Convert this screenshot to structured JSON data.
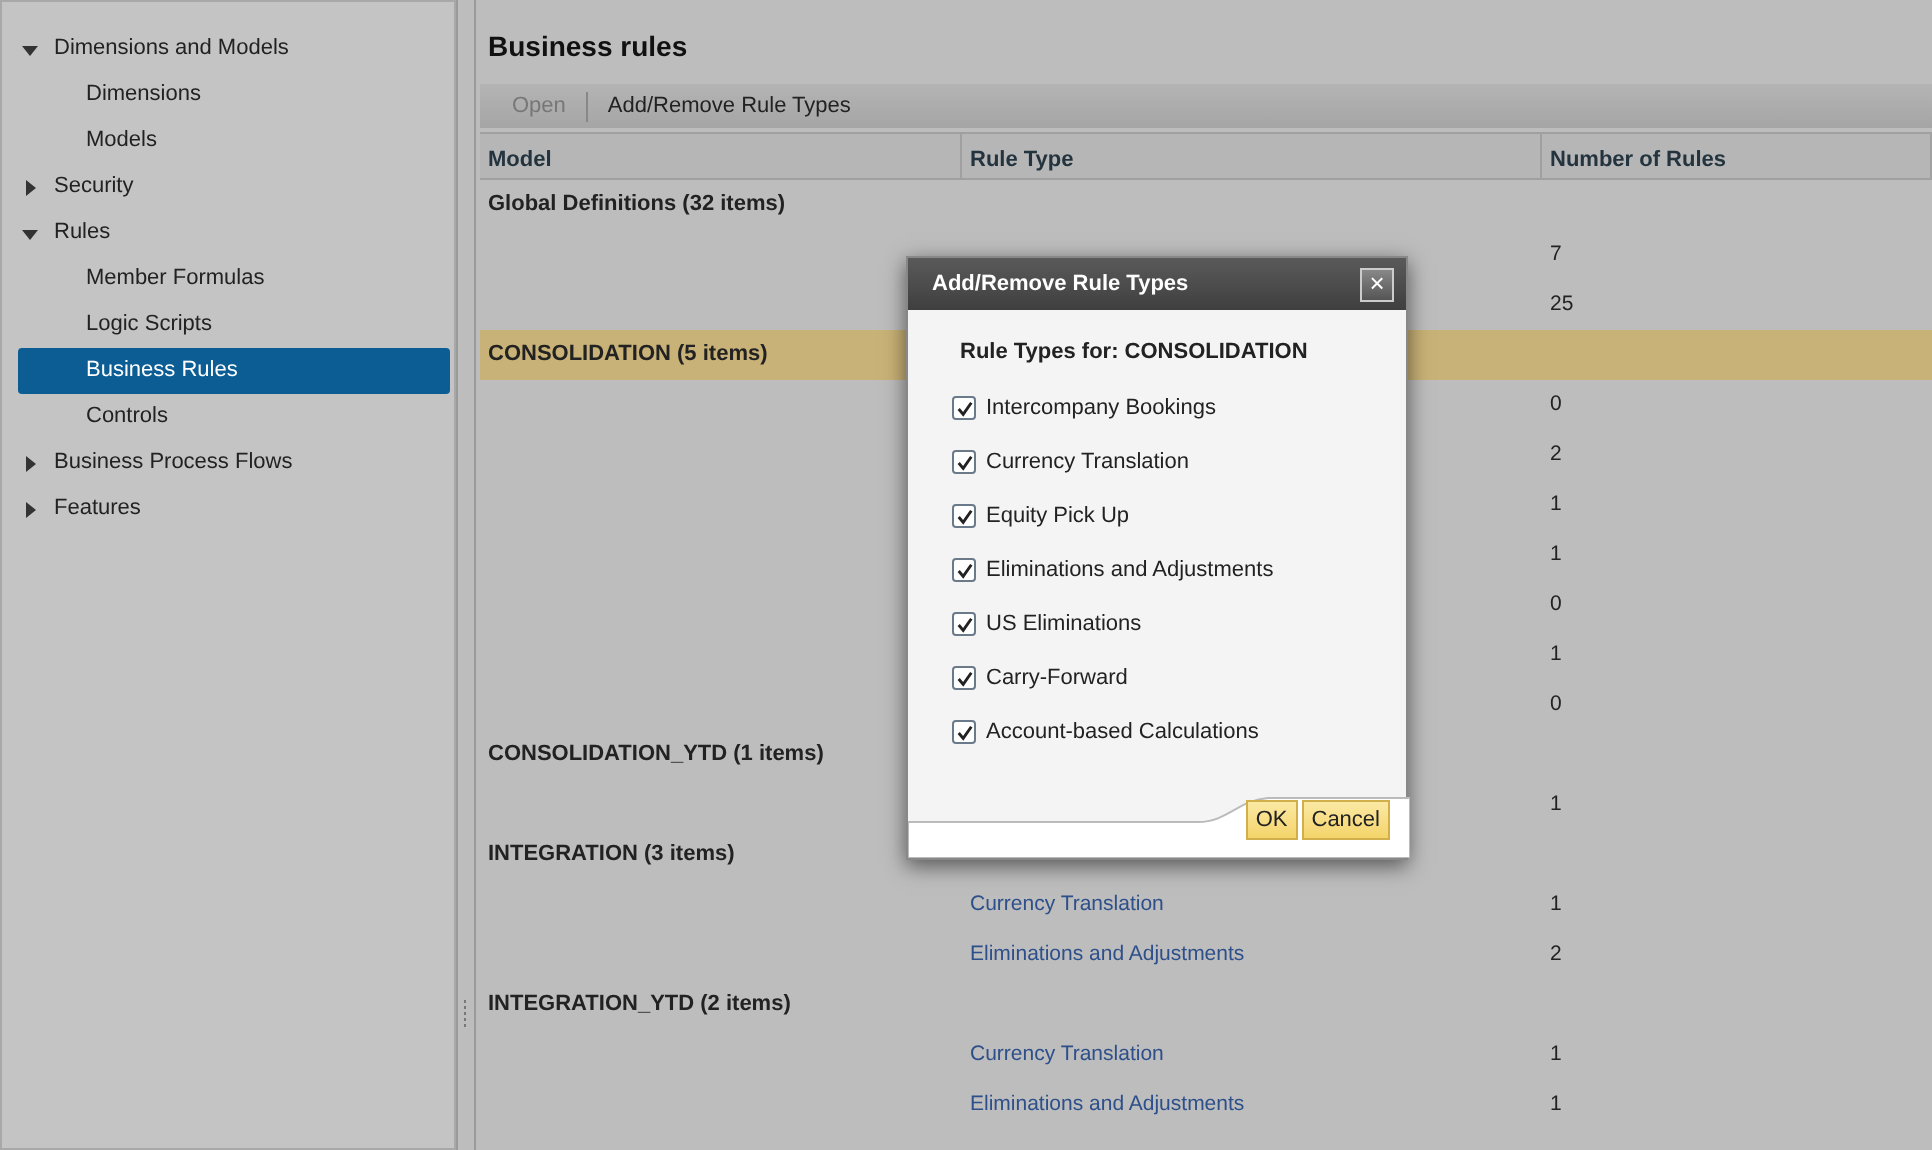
{
  "sidebar": {
    "items": [
      {
        "label": "Dimensions and Models",
        "expanded": true,
        "children": [
          {
            "label": "Dimensions",
            "selected": false
          },
          {
            "label": "Models",
            "selected": false
          }
        ]
      },
      {
        "label": "Security",
        "expanded": false
      },
      {
        "label": "Rules",
        "expanded": true,
        "children": [
          {
            "label": "Member Formulas",
            "selected": false
          },
          {
            "label": "Logic Scripts",
            "selected": false
          },
          {
            "label": "Business Rules",
            "selected": true
          },
          {
            "label": "Controls",
            "selected": false
          }
        ]
      },
      {
        "label": "Business Process Flows",
        "expanded": false
      },
      {
        "label": "Features",
        "expanded": false
      }
    ]
  },
  "page_title": "Business rules",
  "toolbar": [
    {
      "label": "Open",
      "disabled": true
    },
    {
      "label": "Add/Remove Rule Types",
      "disabled": false
    }
  ],
  "table": {
    "columns": [
      "Model",
      "Rule Type",
      "Number of Rules"
    ],
    "groups": [
      {
        "title": "Global Definitions (32 items)",
        "highlighted": false,
        "rows": [
          {
            "count": "7"
          },
          {
            "count": "25"
          }
        ]
      },
      {
        "title": "CONSOLIDATION (5 items)",
        "highlighted": true,
        "rows": [
          {
            "count": "0"
          },
          {
            "count": "2"
          },
          {
            "count": "1"
          },
          {
            "count": "1"
          },
          {
            "count": "0"
          },
          {
            "count": "1"
          },
          {
            "count": "0"
          }
        ]
      },
      {
        "title": "CONSOLIDATION_YTD (1 items)",
        "highlighted": false,
        "rows": [
          {
            "count": "1"
          }
        ]
      },
      {
        "title": "INTEGRATION (3 items)",
        "highlighted": false,
        "rows": [
          {
            "rule_type": "Currency Translation",
            "count": "1"
          },
          {
            "rule_type": "Eliminations and Adjustments",
            "count": "2"
          }
        ]
      },
      {
        "title": "INTEGRATION_YTD (2 items)",
        "highlighted": false,
        "rows": [
          {
            "rule_type": "Currency Translation",
            "count": "1"
          },
          {
            "rule_type": "Eliminations and Adjustments",
            "count": "1"
          }
        ]
      }
    ]
  },
  "dialog": {
    "title": "Add/Remove Rule Types",
    "close": "×",
    "heading": "Rule Types for: CONSOLIDATION",
    "options": [
      {
        "label": "Intercompany Bookings",
        "checked": true
      },
      {
        "label": "Currency Translation",
        "checked": true
      },
      {
        "label": "Equity Pick Up",
        "checked": true
      },
      {
        "label": "Eliminations and Adjustments",
        "checked": true
      },
      {
        "label": "US Eliminations",
        "checked": true
      },
      {
        "label": "Carry-Forward",
        "checked": true
      },
      {
        "label": "Account-based Calculations",
        "checked": true
      }
    ],
    "buttons": [
      "OK",
      "Cancel"
    ]
  }
}
